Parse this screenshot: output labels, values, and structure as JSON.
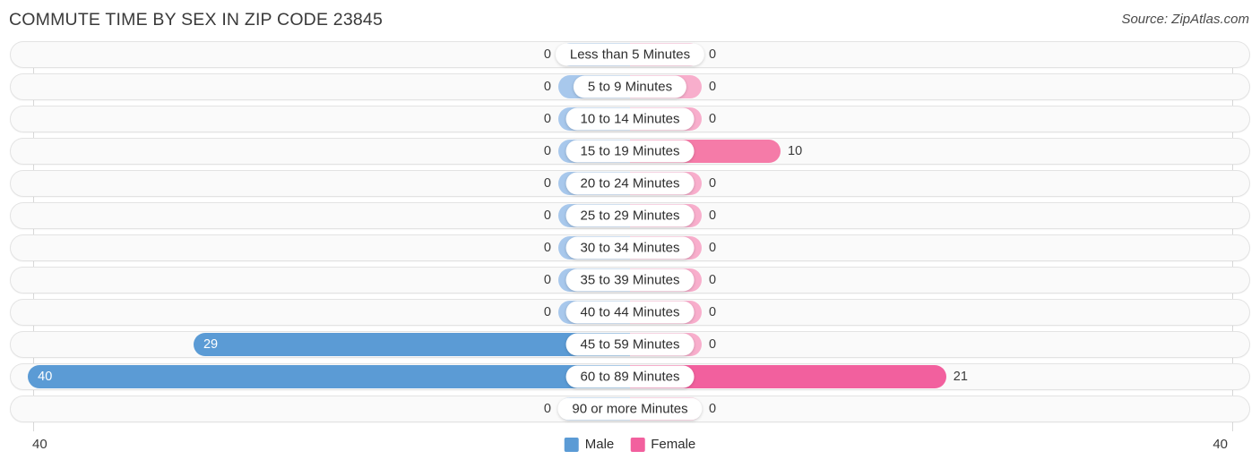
{
  "header": {
    "title": "COMMUTE TIME BY SEX IN ZIP CODE 23845",
    "source": "Source: ZipAtlas.com"
  },
  "legend": {
    "male_label": "Male",
    "female_label": "Female",
    "male_color": "#5B9BD5",
    "female_color": "#F2609E"
  },
  "axis": {
    "left_label": "40",
    "right_label": "40"
  },
  "colors": {
    "male_zero": "#A8C8EC",
    "female_zero": "#F8AECC",
    "male_active": "#5B9BD5",
    "female_active": "#F2609E",
    "female_mid": "#F57BA8",
    "track_bg": "#FAFAFA",
    "track_border": "#E3E3E3",
    "gridline": "#D8D8D8"
  },
  "chart_data": {
    "type": "bar",
    "title": "COMMUTE TIME BY SEX IN ZIP CODE 23845",
    "subtitle": "",
    "xlabel": "",
    "ylabel": "",
    "orientation": "horizontal-diverging",
    "axis_max": 40,
    "xlim": [
      40,
      0,
      40
    ],
    "grid": true,
    "legend_position": "bottom-center",
    "categories": [
      "Less than 5 Minutes",
      "5 to 9 Minutes",
      "10 to 14 Minutes",
      "15 to 19 Minutes",
      "20 to 24 Minutes",
      "25 to 29 Minutes",
      "30 to 34 Minutes",
      "35 to 39 Minutes",
      "40 to 44 Minutes",
      "45 to 59 Minutes",
      "60 to 89 Minutes",
      "90 or more Minutes"
    ],
    "series": [
      {
        "name": "Male",
        "color": "#5B9BD5",
        "values": [
          0,
          0,
          0,
          0,
          0,
          0,
          0,
          0,
          0,
          29,
          40,
          0
        ]
      },
      {
        "name": "Female",
        "color": "#F2609E",
        "values": [
          0,
          0,
          0,
          10,
          0,
          0,
          0,
          0,
          0,
          0,
          21,
          0
        ]
      }
    ]
  },
  "rows": [
    {
      "label": "Less than 5 Minutes",
      "male": "0",
      "female": "0"
    },
    {
      "label": "5 to 9 Minutes",
      "male": "0",
      "female": "0"
    },
    {
      "label": "10 to 14 Minutes",
      "male": "0",
      "female": "0"
    },
    {
      "label": "15 to 19 Minutes",
      "male": "0",
      "female": "10"
    },
    {
      "label": "20 to 24 Minutes",
      "male": "0",
      "female": "0"
    },
    {
      "label": "25 to 29 Minutes",
      "male": "0",
      "female": "0"
    },
    {
      "label": "30 to 34 Minutes",
      "male": "0",
      "female": "0"
    },
    {
      "label": "35 to 39 Minutes",
      "male": "0",
      "female": "0"
    },
    {
      "label": "40 to 44 Minutes",
      "male": "0",
      "female": "0"
    },
    {
      "label": "45 to 59 Minutes",
      "male": "29",
      "female": "0"
    },
    {
      "label": "60 to 89 Minutes",
      "male": "40",
      "female": "21"
    },
    {
      "label": "90 or more Minutes",
      "male": "0",
      "female": "0"
    }
  ]
}
